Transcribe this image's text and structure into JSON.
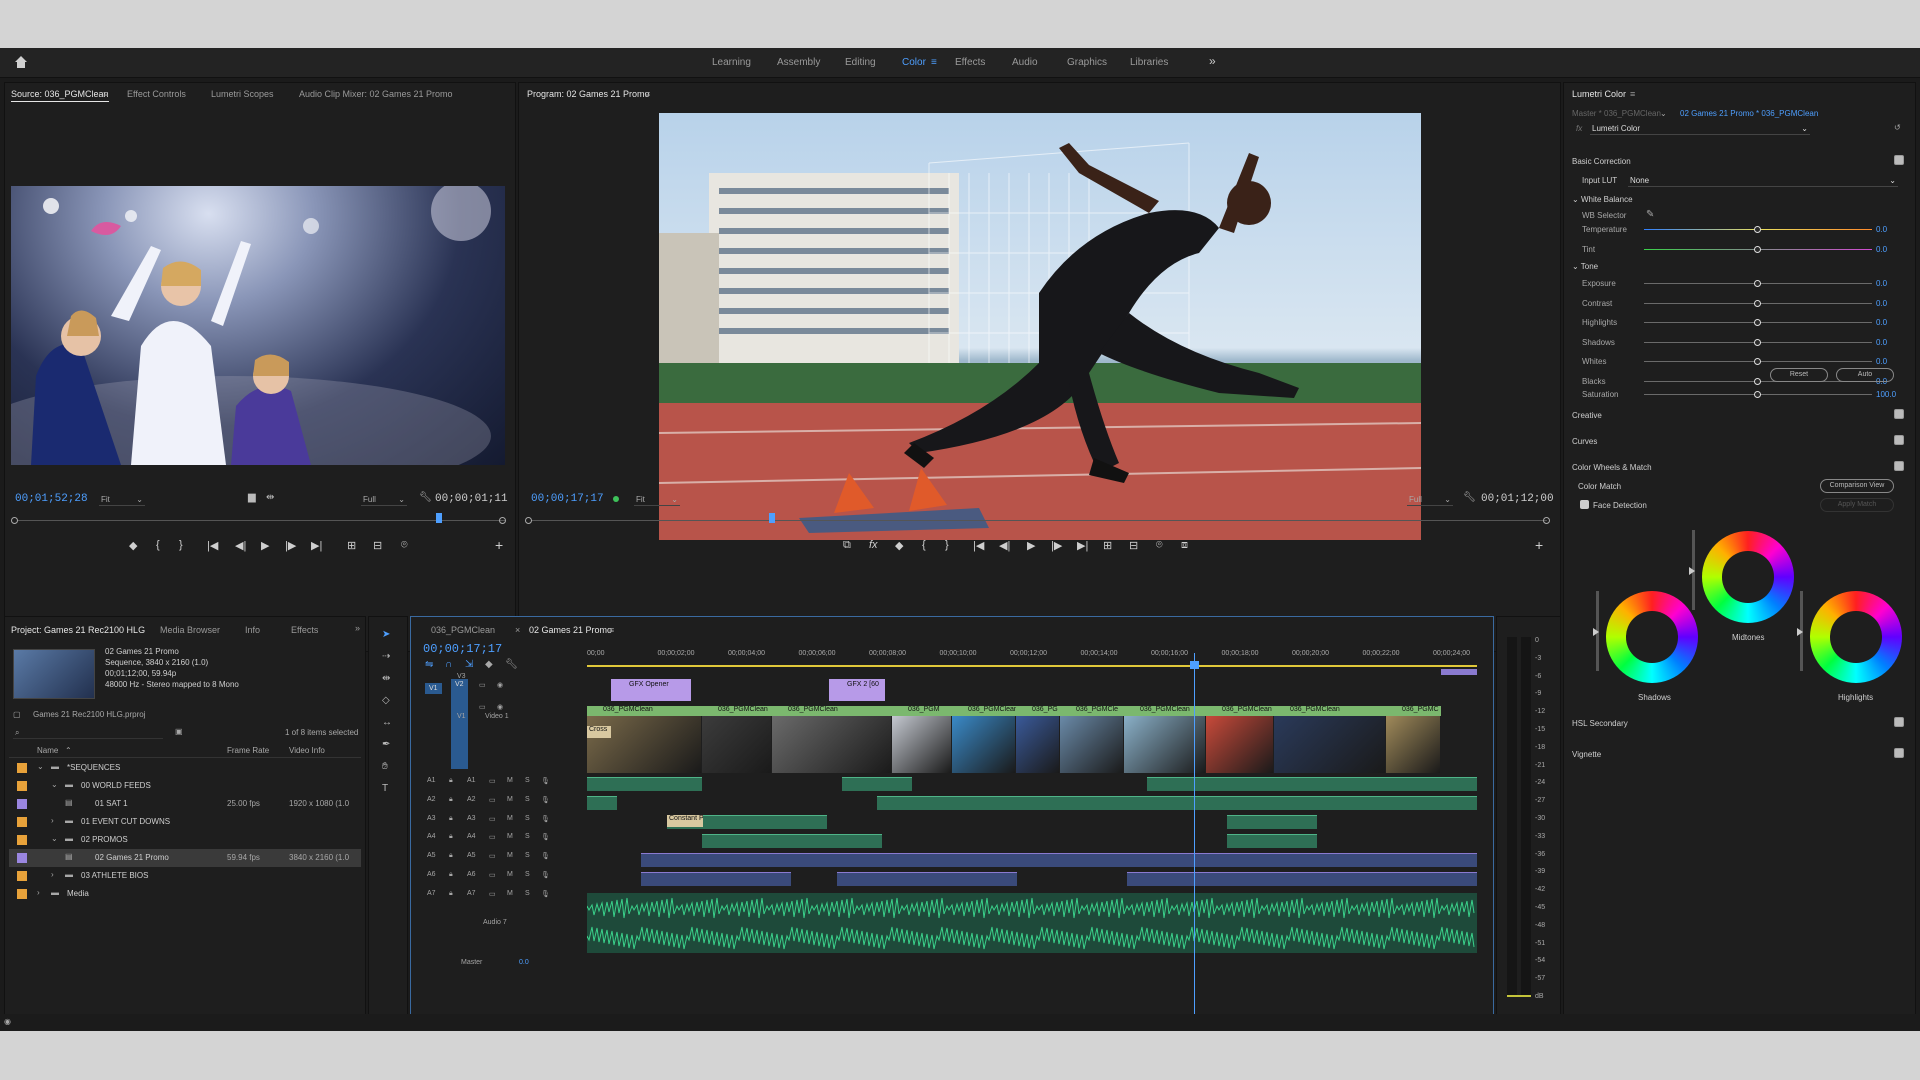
{
  "workspaces": [
    "Learning",
    "Assembly",
    "Editing",
    "Color",
    "Effects",
    "Audio",
    "Graphics",
    "Libraries"
  ],
  "active_workspace": "Color",
  "more_icon": "»",
  "source": {
    "tabs": [
      "Source: 036_PGMClean",
      "Effect Controls",
      "Lumetri Scopes",
      "Audio Clip Mixer: 02 Games 21 Promo"
    ],
    "timecode": "00;01;52;28",
    "fit": "Fit",
    "quality": "Full",
    "duration": "00;00;01;11"
  },
  "program": {
    "tab": "Program: 02 Games 21 Promo",
    "timecode": "00;00;17;17",
    "fit": "Fit",
    "quality": "Full",
    "duration": "00;01;12;00"
  },
  "project": {
    "tabs": [
      "Project: Games 21 Rec2100 HLG",
      "Media Browser",
      "Info",
      "Effects"
    ],
    "clip_name": "02 Games 21 Promo",
    "clip_info1": "Sequence, 3840 x 2160 (1.0)",
    "clip_info2": "00;01;12;00, 59.94p",
    "clip_info3": "48000 Hz - Stereo mapped to 8 Mono",
    "file": "Games 21 Rec2100 HLG.prproj",
    "selection": "1 of 8 items selected",
    "columns": [
      "Name",
      "Frame Rate",
      "Video Info"
    ],
    "items": [
      {
        "name": "*SEQUENCES",
        "fps": "",
        "info": "",
        "color": "#e8a23a",
        "indent": 1,
        "twirl": "⌄"
      },
      {
        "name": "00 WORLD FEEDS",
        "fps": "",
        "info": "",
        "color": "#e8a23a",
        "indent": 2,
        "twirl": "⌄"
      },
      {
        "name": "01 SAT 1",
        "fps": "25.00 fps",
        "info": "1920 x 1080 (1.0",
        "color": "#9a86e0",
        "indent": 3,
        "twirl": ""
      },
      {
        "name": "01 EVENT CUT DOWNS",
        "fps": "",
        "info": "",
        "color": "#e8a23a",
        "indent": 2,
        "twirl": "›"
      },
      {
        "name": "02 PROMOS",
        "fps": "",
        "info": "",
        "color": "#e8a23a",
        "indent": 2,
        "twirl": "⌄"
      },
      {
        "name": "02 Games 21 Promo",
        "fps": "59.94 fps",
        "info": "3840 x 2160 (1.0",
        "color": "#9a86e0",
        "indent": 3,
        "twirl": "",
        "selected": true
      },
      {
        "name": "03 ATHLETE BIOS",
        "fps": "",
        "info": "",
        "color": "#e8a23a",
        "indent": 2,
        "twirl": "›"
      },
      {
        "name": "Media",
        "fps": "",
        "info": "",
        "color": "#e8a23a",
        "indent": 1,
        "twirl": "›"
      }
    ]
  },
  "timeline": {
    "tabs": [
      "036_PGMClean",
      "02 Games 21 Promo"
    ],
    "timecode": "00;00;17;17",
    "ruler": [
      "00;00",
      "00;00;02;00",
      "00;00;04;00",
      "00;00;06;00",
      "00;00;08;00",
      "00;00;10;00",
      "00;00;12;00",
      "00;00;14;00",
      "00;00;16;00",
      "00;00;18;00",
      "00;00;20;00",
      "00;00;22;00",
      "00;00;24;00"
    ],
    "video_tracks": [
      "V3",
      "V2",
      "V1"
    ],
    "video1_label": "Video 1",
    "audio_tracks": [
      "A1",
      "A2",
      "A3",
      "A4",
      "A5",
      "A6",
      "A7"
    ],
    "audio7_label": "Audio 7",
    "master_label": "Master",
    "master_value": "0.0",
    "gfx_clips": [
      "GFX Opener",
      "GFX 2 [60"
    ],
    "v1_clips": [
      "036_PGMClean",
      "036_PGMClean",
      "036_PGMClean",
      "036_PGM",
      "036_PGMClean [",
      "036_PG",
      "036_PGMCle",
      "036_PGMClean",
      "036_PGMClean",
      "036_PGMClean",
      "036_PGMC"
    ],
    "cross_label": "Cross",
    "constant_label": "Constant P",
    "meter_scale": [
      "0",
      "-3",
      "-6",
      "-9",
      "-12",
      "-15",
      "-18",
      "-21",
      "-24",
      "-27",
      "-30",
      "-33",
      "-36",
      "-39",
      "-42",
      "-45",
      "-48",
      "-51",
      "-54",
      "-57",
      "dB"
    ],
    "solo": [
      "S",
      "S"
    ]
  },
  "lumetri": {
    "title": "Lumetri Color",
    "master": "Master * 036_PGMClean",
    "sequence": "02 Games 21 Promo * 036_PGMClean",
    "effect": "Lumetri Color",
    "basic": "Basic Correction",
    "input_lut_label": "Input LUT",
    "input_lut": "None",
    "white_balance": "White Balance",
    "wb_selector": "WB Selector",
    "wb_params": [
      {
        "name": "Temperature",
        "value": "0.0",
        "level": 0.5
      },
      {
        "name": "Tint",
        "value": "0.0",
        "level": 0.5
      }
    ],
    "tone": "Tone",
    "tone_params": [
      {
        "name": "Exposure",
        "value": "0.0",
        "level": 0.5
      },
      {
        "name": "Contrast",
        "value": "0.0",
        "level": 0.5
      },
      {
        "name": "Highlights",
        "value": "0.0",
        "level": 0.5
      },
      {
        "name": "Shadows",
        "value": "0.0",
        "level": 0.5
      },
      {
        "name": "Whites",
        "value": "0.0",
        "level": 0.5
      },
      {
        "name": "Blacks",
        "value": "0.0",
        "level": 0.5
      }
    ],
    "reset": "Reset",
    "auto": "Auto",
    "saturation": {
      "name": "Saturation",
      "value": "100.0",
      "level": 0.5
    },
    "creative": "Creative",
    "curves": "Curves",
    "color_wheels": "Color Wheels & Match",
    "color_match": "Color Match",
    "comparison_view": "Comparison View",
    "face_detection": "Face Detection",
    "apply_match": "Apply Match",
    "wheels": [
      "Midtones",
      "Shadows",
      "Highlights"
    ],
    "hsl": "HSL Secondary",
    "vignette": "Vignette"
  }
}
